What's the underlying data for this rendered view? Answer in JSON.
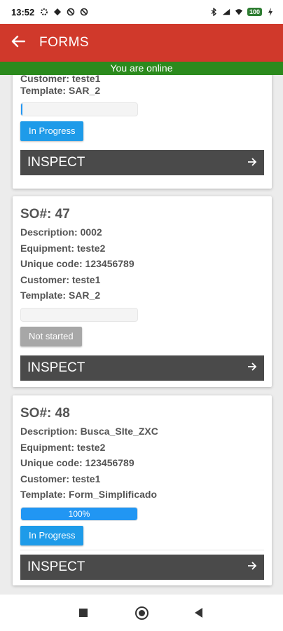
{
  "status_bar": {
    "time": "13:52",
    "battery": "100",
    "icons": [
      "settings-icon",
      "diamond-icon",
      "block-icon",
      "block-icon",
      "bluetooth-icon",
      "signal-icon",
      "wifi-icon",
      "battery-icon",
      "charging-icon"
    ]
  },
  "app_bar": {
    "title": "FORMS",
    "back_icon": "arrow-left-icon"
  },
  "banner": {
    "text": "You are online",
    "color": "#2b8a1d"
  },
  "colors": {
    "app_bar": "#d0392b",
    "in_progress": "#1e9be9",
    "not_started": "#a7a7a7",
    "inspect": "#4a4a4a"
  },
  "cards": [
    {
      "customer": "Customer: teste1",
      "template": "Template: SAR_2",
      "progress_value": 0.01,
      "status": "In Progress",
      "inspect_label": "INSPECT"
    },
    {
      "so": "SO#: 47",
      "description": "Description: 0002",
      "equipment": "Equipment: teste2",
      "unique_code": "Unique code: 123456789",
      "customer": "Customer: teste1",
      "template": "Template: SAR_2",
      "progress_value": 0,
      "status": "Not started",
      "inspect_label": "INSPECT"
    },
    {
      "so": "SO#: 48",
      "description": "Description: Busca_SIte_ZXC",
      "equipment": "Equipment: teste2",
      "unique_code": "Unique code: 123456789",
      "customer": "Customer: teste1",
      "template": "Template: Form_Simplificado",
      "progress_value": 1.0,
      "progress_label": "100%",
      "status": "In Progress",
      "inspect_label": "INSPECT"
    }
  ]
}
